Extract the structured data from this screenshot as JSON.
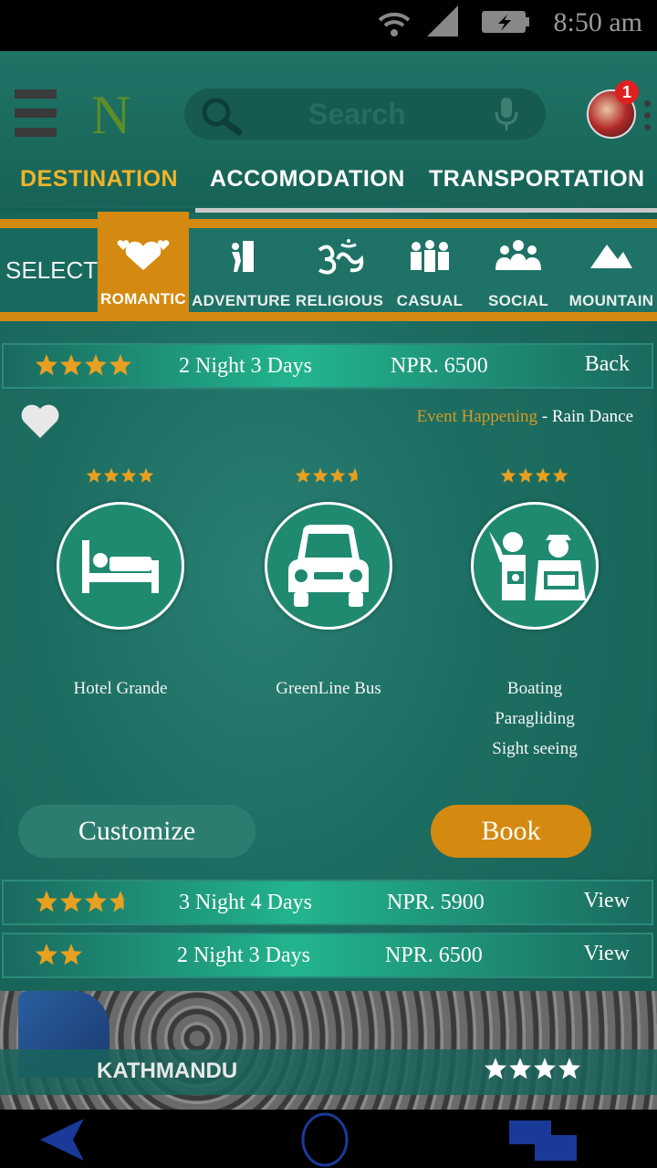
{
  "status": {
    "time": "8:50 am"
  },
  "header": {
    "logo": "N",
    "search_placeholder": "Search",
    "notification_count": "1"
  },
  "tabs": [
    {
      "label": "DESTINATION",
      "active": true
    },
    {
      "label": "ACCOMODATION",
      "active": false
    },
    {
      "label": "TRANSPORTATION",
      "active": false
    }
  ],
  "categories": {
    "select_label": "SELECT",
    "items": [
      {
        "label": "ROMANTIC",
        "icon": "hearts-icon",
        "active": true
      },
      {
        "label": "ADVENTURE",
        "icon": "climbing-icon",
        "active": false
      },
      {
        "label": "RELIGIOUS",
        "icon": "om-icon",
        "active": false
      },
      {
        "label": "CASUAL",
        "icon": "group-icon",
        "active": false
      },
      {
        "label": "SOCIAL",
        "icon": "people-icon",
        "active": false
      },
      {
        "label": "MOUNTAIN",
        "icon": "mountain-icon",
        "active": false
      }
    ]
  },
  "packages": [
    {
      "rating": 4,
      "duration": "2 Night 3 Days",
      "price": "NPR. 6500",
      "action": "Back"
    },
    {
      "rating": 3.5,
      "duration": "3 Night 4 Days",
      "price": "NPR. 5900",
      "action": "View"
    },
    {
      "rating": 2,
      "duration": "2 Night 3 Days",
      "price": "NPR. 6500",
      "action": "View"
    }
  ],
  "detail": {
    "event_label": "Event Happening",
    "event_separator": " - ",
    "event_name": "Rain Dance",
    "items": [
      {
        "rating": 4,
        "icon": "bed-icon",
        "lines": [
          "Hotel Grande"
        ]
      },
      {
        "rating": 3.5,
        "icon": "car-icon",
        "lines": [
          "GreenLine Bus"
        ]
      },
      {
        "rating": 4,
        "icon": "tourists-icon",
        "lines": [
          "Boating",
          "Paragliding",
          "Sight seeing"
        ]
      }
    ],
    "customize_label": "Customize",
    "book_label": "Book"
  },
  "city": {
    "name": "KATHMANDU",
    "rating": 4
  },
  "colors": {
    "accent": "#d48a10",
    "star": "#e8a020",
    "teal": "#1d6e62"
  }
}
